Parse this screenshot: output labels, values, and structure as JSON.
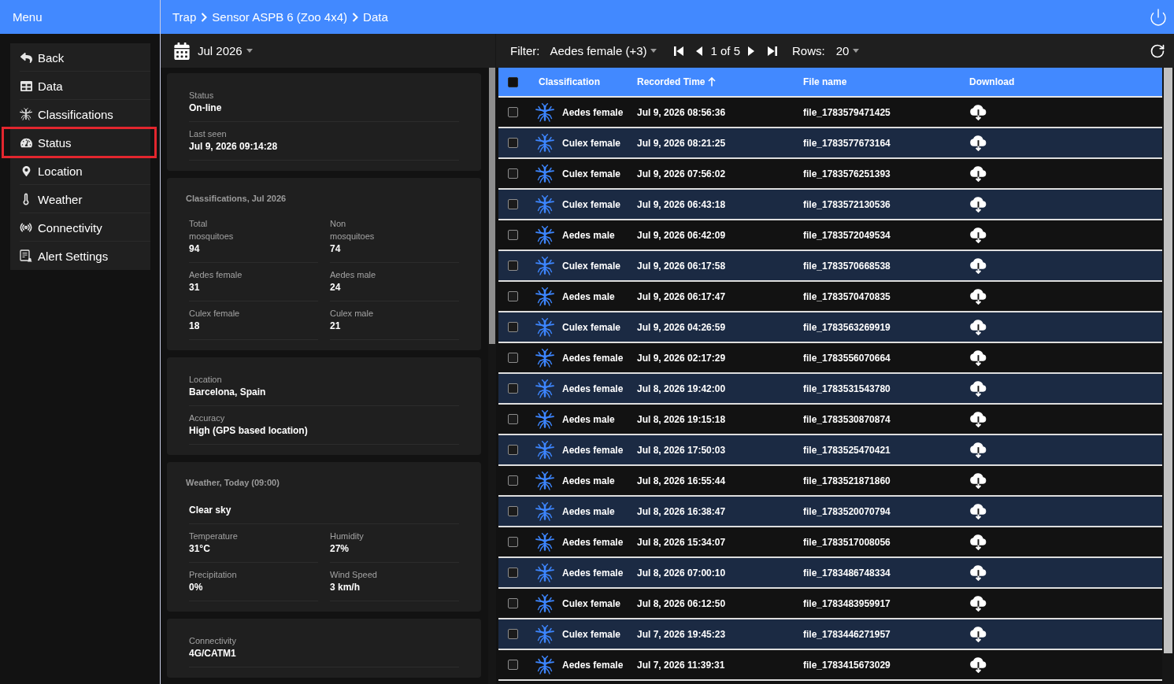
{
  "sidebar": {
    "title": "Menu",
    "items": [
      {
        "label": "Back",
        "selected": false
      },
      {
        "label": "Data",
        "selected": false
      },
      {
        "label": "Classifications",
        "selected": false
      },
      {
        "label": "Status",
        "selected": true
      },
      {
        "label": "Location",
        "selected": false
      },
      {
        "label": "Weather",
        "selected": false
      },
      {
        "label": "Connectivity",
        "selected": false
      },
      {
        "label": "Alert Settings",
        "selected": false
      }
    ]
  },
  "breadcrumb": [
    "Trap",
    "Sensor ASPB 6 (Zoo 4x4)",
    "Data"
  ],
  "date_picker": {
    "value": "Jul 2026"
  },
  "cards": [
    {
      "kind": "list",
      "fields": [
        {
          "label": "Status",
          "value": "On-line"
        },
        {
          "label": "Last seen",
          "value": "Jul 9, 2026 09:14:28"
        }
      ]
    },
    {
      "kind": "grid",
      "title": "Classifications, Jul 2026",
      "fields": [
        {
          "label": "Total mosquitoes",
          "value": "94"
        },
        {
          "label": "Non mosquitoes",
          "value": "74"
        },
        {
          "label": "Aedes female",
          "value": "31"
        },
        {
          "label": "Aedes male",
          "value": "24"
        },
        {
          "label": "Culex female",
          "value": "18"
        },
        {
          "label": "Culex male",
          "value": "21"
        }
      ]
    },
    {
      "kind": "list",
      "fields": [
        {
          "label": "Location",
          "value": "Barcelona, Spain"
        },
        {
          "label": "Accuracy",
          "value": "High (GPS based location)"
        }
      ]
    },
    {
      "kind": "grid",
      "title": "Weather, Today (09:00)",
      "summary": "Clear sky",
      "fields": [
        {
          "label": "Temperature",
          "value": "31°C"
        },
        {
          "label": "Humidity",
          "value": "27%"
        },
        {
          "label": "Precipitation",
          "value": "0%"
        },
        {
          "label": "Wind Speed",
          "value": "3 km/h"
        }
      ]
    },
    {
      "kind": "list",
      "fields": [
        {
          "label": "Connectivity",
          "value": "4G/CATM1"
        }
      ]
    }
  ],
  "filter": {
    "label": "Filter:",
    "value": "Aedes female (+3)"
  },
  "pagination": {
    "page_text": "1 of 5"
  },
  "rows_per_page": {
    "label": "Rows:",
    "value": "20"
  },
  "table": {
    "select_all": {
      "checked": false
    },
    "columns": [
      {
        "label": "Classification",
        "sorted": false
      },
      {
        "label": "Recorded Time",
        "sorted": true
      },
      {
        "label": "File name",
        "sorted": false
      },
      {
        "label": "Download",
        "sorted": false
      }
    ],
    "rows": [
      {
        "checked": false,
        "classification": "Aedes female",
        "recorded_time": "Jul 9, 2026 08:56:36",
        "file_name": "file_1783579471425"
      },
      {
        "checked": false,
        "classification": "Culex female",
        "recorded_time": "Jul 9, 2026 08:21:25",
        "file_name": "file_1783577673164"
      },
      {
        "checked": false,
        "classification": "Culex female",
        "recorded_time": "Jul 9, 2026 07:56:02",
        "file_name": "file_1783576251393"
      },
      {
        "checked": false,
        "classification": "Culex female",
        "recorded_time": "Jul 9, 2026 06:43:18",
        "file_name": "file_1783572130536"
      },
      {
        "checked": false,
        "classification": "Aedes male",
        "recorded_time": "Jul 9, 2026 06:42:09",
        "file_name": "file_1783572049534"
      },
      {
        "checked": false,
        "classification": "Culex female",
        "recorded_time": "Jul 9, 2026 06:17:58",
        "file_name": "file_1783570668538"
      },
      {
        "checked": false,
        "classification": "Aedes male",
        "recorded_time": "Jul 9, 2026 06:17:47",
        "file_name": "file_1783570470835"
      },
      {
        "checked": false,
        "classification": "Culex female",
        "recorded_time": "Jul 9, 2026 04:26:59",
        "file_name": "file_1783563269919"
      },
      {
        "checked": false,
        "classification": "Aedes female",
        "recorded_time": "Jul 9, 2026 02:17:29",
        "file_name": "file_1783556070664"
      },
      {
        "checked": false,
        "classification": "Aedes female",
        "recorded_time": "Jul 8, 2026 19:42:00",
        "file_name": "file_1783531543780"
      },
      {
        "checked": false,
        "classification": "Aedes male",
        "recorded_time": "Jul 8, 2026 19:15:18",
        "file_name": "file_1783530870874"
      },
      {
        "checked": false,
        "classification": "Aedes female",
        "recorded_time": "Jul 8, 2026 17:50:03",
        "file_name": "file_1783525470421"
      },
      {
        "checked": false,
        "classification": "Aedes male",
        "recorded_time": "Jul 8, 2026 16:55:44",
        "file_name": "file_1783521871860"
      },
      {
        "checked": false,
        "classification": "Aedes male",
        "recorded_time": "Jul 8, 2026 16:38:47",
        "file_name": "file_1783520070794"
      },
      {
        "checked": false,
        "classification": "Aedes female",
        "recorded_time": "Jul 8, 2026 15:34:07",
        "file_name": "file_1783517008056"
      },
      {
        "checked": false,
        "classification": "Aedes female",
        "recorded_time": "Jul 8, 2026 07:00:10",
        "file_name": "file_1783486748334"
      },
      {
        "checked": false,
        "classification": "Culex female",
        "recorded_time": "Jul 8, 2026 06:12:50",
        "file_name": "file_1783483959917"
      },
      {
        "checked": false,
        "classification": "Culex female",
        "recorded_time": "Jul 7, 2026 19:45:23",
        "file_name": "file_1783446271957"
      },
      {
        "checked": false,
        "classification": "Aedes female",
        "recorded_time": "Jul 7, 2026 11:39:31",
        "file_name": "file_1783415673029"
      }
    ]
  }
}
